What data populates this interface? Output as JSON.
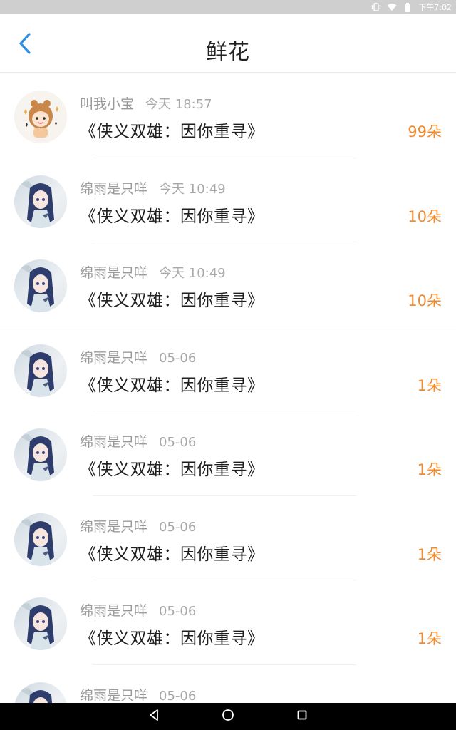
{
  "status_bar": {
    "time": "下午7:02",
    "icons": [
      "vibrate-icon",
      "wifi-icon",
      "battery-icon"
    ]
  },
  "header": {
    "title": "鲜花",
    "back_icon": "chevron-left-icon"
  },
  "colors": {
    "accent_back": "#2f8de4",
    "count": "#f28a2e"
  },
  "records": [
    {
      "user": "叫我小宝",
      "time": "今天 18:57",
      "book": "《侠义双雄：因你重寻》",
      "count": "99朵",
      "avatar": "cartoon-girl"
    },
    {
      "user": "绵雨是只咩",
      "time": "今天 10:49",
      "book": "《侠义双雄：因你重寻》",
      "count": "10朵",
      "avatar": "anime-girl"
    },
    {
      "user": "绵雨是只咩",
      "time": "今天 10:49",
      "book": "《侠义双雄：因你重寻》",
      "count": "10朵",
      "avatar": "anime-girl"
    },
    {
      "user": "绵雨是只咩",
      "time": "05-06",
      "book": "《侠义双雄：因你重寻》",
      "count": "1朵",
      "avatar": "anime-girl"
    },
    {
      "user": "绵雨是只咩",
      "time": "05-06",
      "book": "《侠义双雄：因你重寻》",
      "count": "1朵",
      "avatar": "anime-girl"
    },
    {
      "user": "绵雨是只咩",
      "time": "05-06",
      "book": "《侠义双雄：因你重寻》",
      "count": "1朵",
      "avatar": "anime-girl"
    },
    {
      "user": "绵雨是只咩",
      "time": "05-06",
      "book": "《侠义双雄：因你重寻》",
      "count": "1朵",
      "avatar": "anime-girl"
    },
    {
      "user": "绵雨是只咩",
      "time": "05-06",
      "book": "",
      "count": "",
      "avatar": "anime-girl"
    }
  ],
  "nav_bar": {
    "icons": [
      "back-triangle-icon",
      "home-circle-icon",
      "recents-square-icon"
    ]
  }
}
